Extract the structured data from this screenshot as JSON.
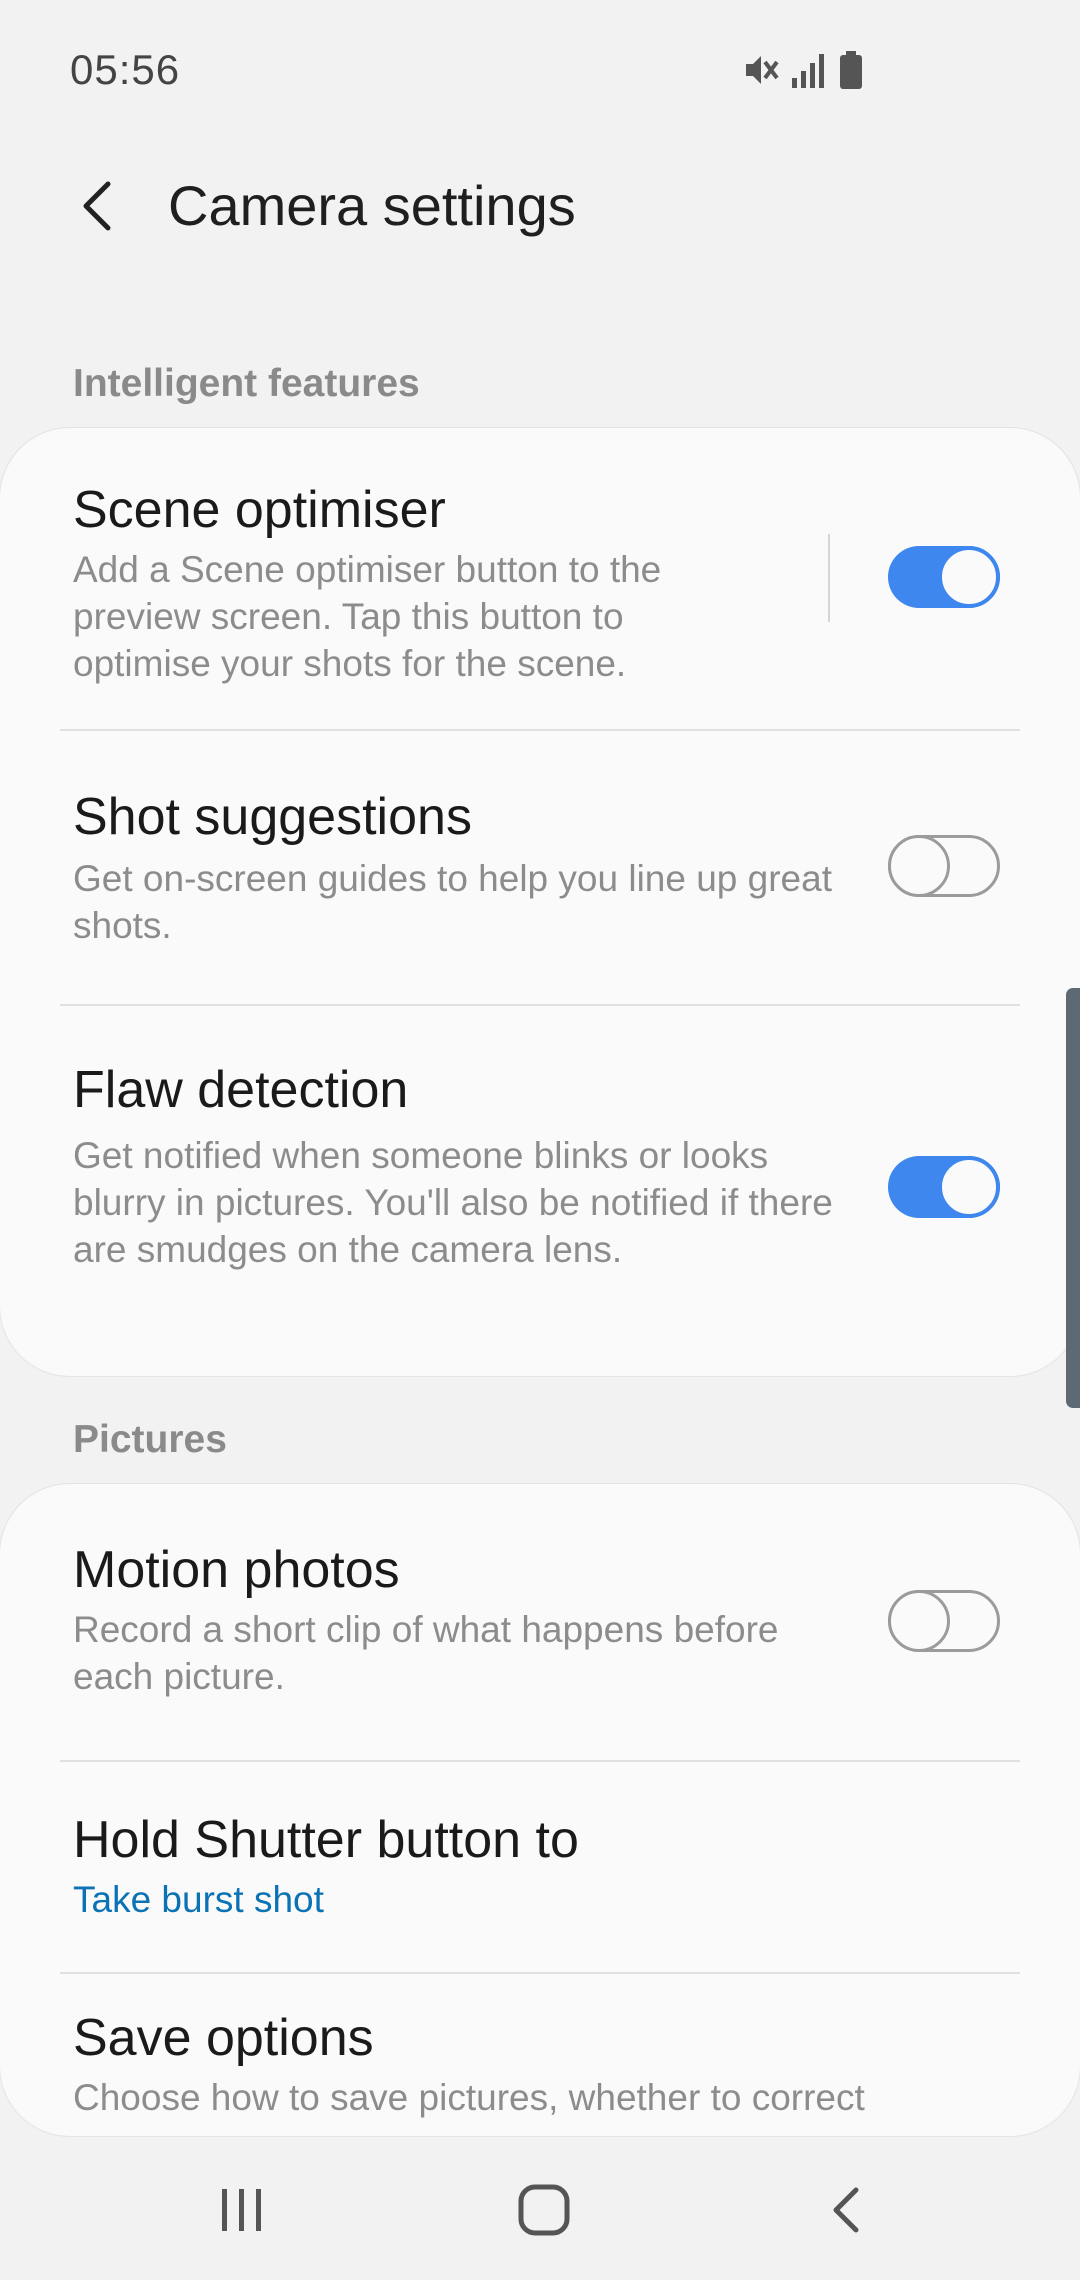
{
  "status_bar": {
    "time": "05:56",
    "icons": [
      "mute-icon",
      "signal-icon",
      "battery-icon"
    ]
  },
  "header": {
    "title": "Camera settings"
  },
  "sections": {
    "intelligent": {
      "label": "Intelligent features",
      "items": {
        "scene": {
          "title": "Scene optimiser",
          "description": "Add a Scene optimiser button to the preview screen. Tap this button to optimise your shots for the scene.",
          "enabled": true
        },
        "shot": {
          "title": "Shot suggestions",
          "description": "Get on-screen guides to help you line up great shots.",
          "enabled": false
        },
        "flaw": {
          "title": "Flaw detection",
          "description": "Get notified when someone blinks or looks blurry in pictures. You'll also be notified if there are smudges on the camera lens.",
          "enabled": true
        }
      }
    },
    "pictures": {
      "label": "Pictures",
      "items": {
        "motion": {
          "title": "Motion photos",
          "description": "Record a short clip of what happens before each picture.",
          "enabled": false
        },
        "hold": {
          "title": "Hold Shutter button to",
          "value": "Take burst shot"
        },
        "save": {
          "title": "Save options",
          "description": "Choose how to save pictures, whether to correct"
        }
      }
    }
  },
  "colors": {
    "accent": "#3e87ee",
    "link": "#0a72b5",
    "background": "#f2f2f2",
    "card": "#fafafa"
  },
  "nav_bar": {
    "icons": [
      "recents-icon",
      "home-icon",
      "back-icon"
    ]
  }
}
